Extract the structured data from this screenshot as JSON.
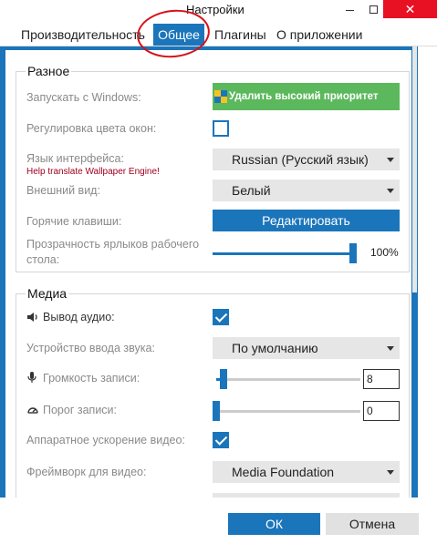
{
  "window": {
    "title": "Настройки"
  },
  "tabs": [
    {
      "label": "Производительность"
    },
    {
      "label": "Общее"
    },
    {
      "label": "Плагины"
    },
    {
      "label": "О приложении"
    }
  ],
  "misc": {
    "title": "Разное",
    "start_with_windows": {
      "label": "Запускать с Windows:",
      "button": "Удалить высокий приоритет"
    },
    "window_color": {
      "label": "Регулировка цвета окон:",
      "checked": false
    },
    "language": {
      "label": "Язык интерфейса:",
      "link": "Help translate Wallpaper Engine!",
      "value": "Russian (Русский язык)"
    },
    "appearance": {
      "label": "Внешний вид:",
      "value": "Белый"
    },
    "hotkeys": {
      "label": "Горячие клавиши:",
      "button": "Редактировать"
    },
    "icon_opacity": {
      "label_line1": "Прозрачность ярлыков рабочего",
      "label_line2": "стола:",
      "value": 1.0,
      "value_text": "100%"
    }
  },
  "media": {
    "title": "Медиа",
    "audio_output": {
      "label": "Вывод аудио:",
      "checked": true,
      "icon": "speaker-icon"
    },
    "input_device": {
      "label": "Устройство ввода звука:",
      "value": "По умолчанию"
    },
    "record_volume": {
      "label": "Громкость записи:",
      "value": "8",
      "level": 0.05,
      "icon": "microphone-icon"
    },
    "record_threshold": {
      "label": "Порог записи:",
      "value": "0",
      "level": 0.0,
      "icon": "gauge-icon"
    },
    "hw_acceleration": {
      "label": "Аппаратное ускорение видео:",
      "checked": true
    },
    "video_framework": {
      "label": "Фреймворк для видео:",
      "value": "Media Foundation"
    }
  },
  "footer": {
    "ok": "ОК",
    "cancel": "Отмена"
  },
  "colors": {
    "accent": "#1b75bb",
    "green": "#5cb85c",
    "close": "#e81123",
    "annotation": "#d8101a"
  }
}
